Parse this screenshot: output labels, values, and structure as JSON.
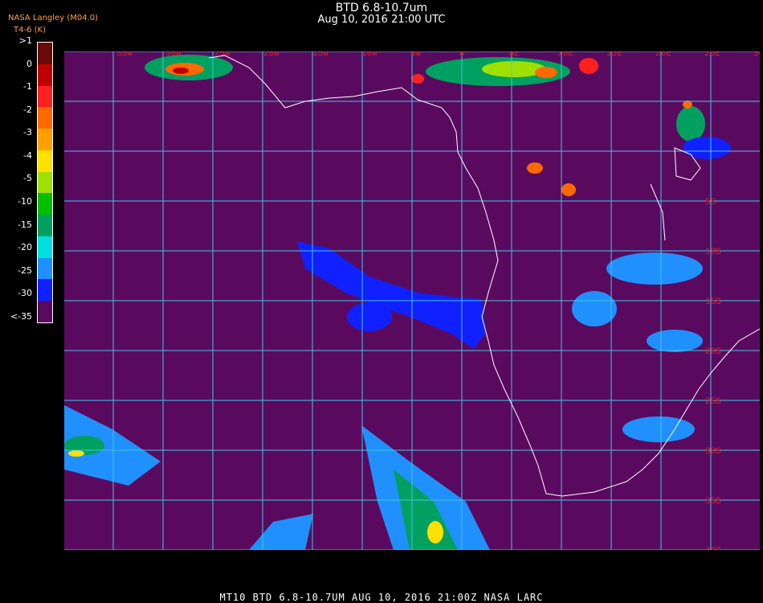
{
  "header": {
    "title": "BTD 6.8-10.7um",
    "subtitle": "Aug 10, 2016 21:00 UTC",
    "credit": "NASA Langley (M04.0)",
    "unit_label": "T4-6 (K)"
  },
  "legend": {
    "labels": [
      ">1",
      "0",
      "-1",
      "-2",
      "-3",
      "-4",
      "-5",
      "-10",
      "-15",
      "-20",
      "-25",
      "-30",
      "<-35"
    ],
    "colors": [
      "#6b0a0a",
      "#c00000",
      "#ff2020",
      "#ff6a00",
      "#ffa000",
      "#ffe000",
      "#a0e000",
      "#00c000",
      "#00a060",
      "#00e0e0",
      "#2090ff",
      "#1020ff",
      "#5a0a5e"
    ]
  },
  "map": {
    "lon_labels": [
      "35W",
      "30W",
      "25W",
      "20W",
      "15W",
      "10W",
      "5W",
      "0",
      "5E",
      "10E",
      "15E",
      "20E",
      "25E",
      "30E",
      "35E"
    ],
    "lat_labels": [
      "5S",
      "10S",
      "15S",
      "20S",
      "25S",
      "30S",
      "35S",
      "40S"
    ],
    "colors": {
      "background": "#5a0a5e",
      "grid": "#3cc8e6",
      "coast": "#ffffff",
      "tick": "#e0202a"
    }
  },
  "footer": {
    "text": "MT10  BTD 6.8-10.7UM   AUG 10, 2016 21:00Z   NASA LARC"
  }
}
